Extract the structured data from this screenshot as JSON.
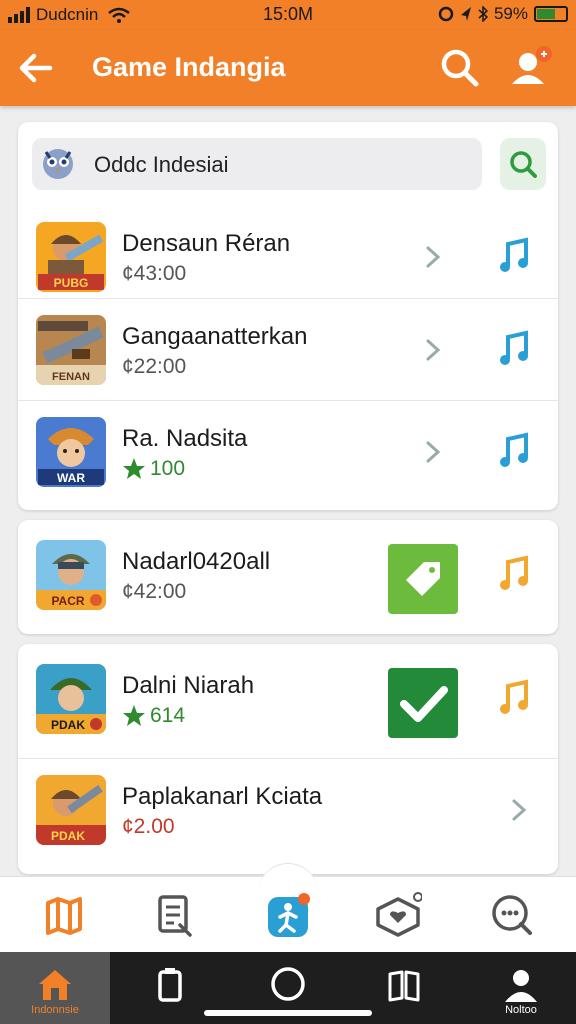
{
  "status_bar": {
    "carrier": "Dudcnin",
    "time": "15:0M",
    "battery": "59%",
    "battery_level": 0.59
  },
  "app_bar": {
    "title": "Game Indangia",
    "back_icon": "arrow-left-icon",
    "search_icon": "search-icon",
    "profile_icon": "user-profile-icon"
  },
  "search": {
    "query": "Oddc Indesiai",
    "icon": "owl-mascot-icon",
    "button_icon": "search-icon"
  },
  "colors": {
    "brand": "#f28028",
    "note_blue": "#2a9fd6",
    "note_orange": "#f0a830",
    "green_light": "#6dbb3c",
    "green_dark": "#238a3a",
    "rating_green": "#2e8b2e",
    "price_red": "#c0392b"
  },
  "games": [
    {
      "name": "Densaun Réran",
      "price": "¢43:00",
      "badge": "PUBG",
      "thumb_bg": "#f5a623"
    },
    {
      "name": "Gangaanatterkan",
      "price": "¢22:00",
      "badge": "FENAN",
      "thumb_bg": "#b8874f"
    },
    {
      "name": "Ra. Nadsita",
      "rating": "100",
      "badge": "WAR",
      "thumb_bg": "#4a7bd0"
    }
  ],
  "featured": [
    {
      "name": "Nadarl0420all",
      "price": "¢42:00",
      "badge": "PACR",
      "thumb_bg": "#7fc3e8",
      "action_icon": "tag-icon"
    }
  ],
  "more": [
    {
      "name": "Dalni  Niarah",
      "rating": "614",
      "badge": "PDAK",
      "thumb_bg": "#3aa0c8",
      "action_icon": "checkmark-icon"
    },
    {
      "name": "Paplakanarl Kciata",
      "price": "¢2.00",
      "badge": "PDAK",
      "thumb_bg": "#f0a830"
    }
  ],
  "tab_bar": {
    "tabs": [
      "map-icon",
      "notes-icon",
      "activity-icon",
      "ticket-heart-icon",
      "chat-icon"
    ]
  },
  "nav_bar": {
    "home_label": "Indonnsie",
    "profile_label": "Noltoo"
  }
}
